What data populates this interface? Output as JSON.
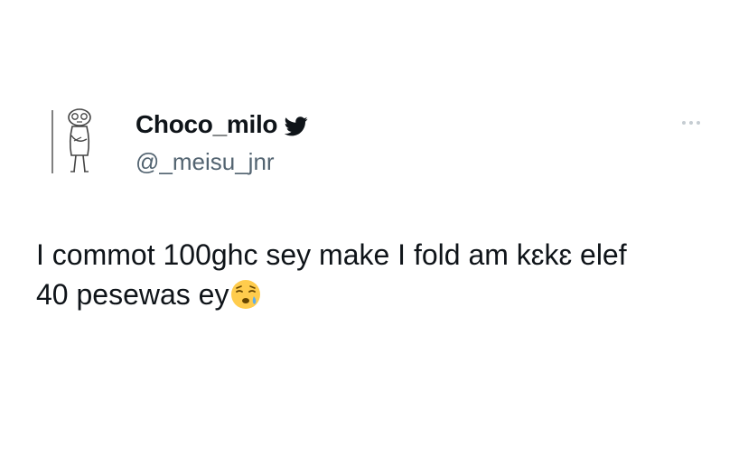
{
  "user": {
    "display_name": "Choco_milo",
    "handle": "@_meisu_jnr",
    "avatar_icon": "stick-figure-avatar-icon",
    "badge_icon": "twitter-bird-icon"
  },
  "menu": {
    "icon": "more-options-icon"
  },
  "tweet": {
    "line1": "I commot 100ghc sey make I fold am  kɛkɛ elef",
    "line2": "40 pesewas ey",
    "emoji_icon": "sleepy-face-emoji"
  },
  "colors": {
    "text": "#0f1419",
    "secondary": "#536471",
    "twitter_blue_dark": "#0f1419"
  }
}
